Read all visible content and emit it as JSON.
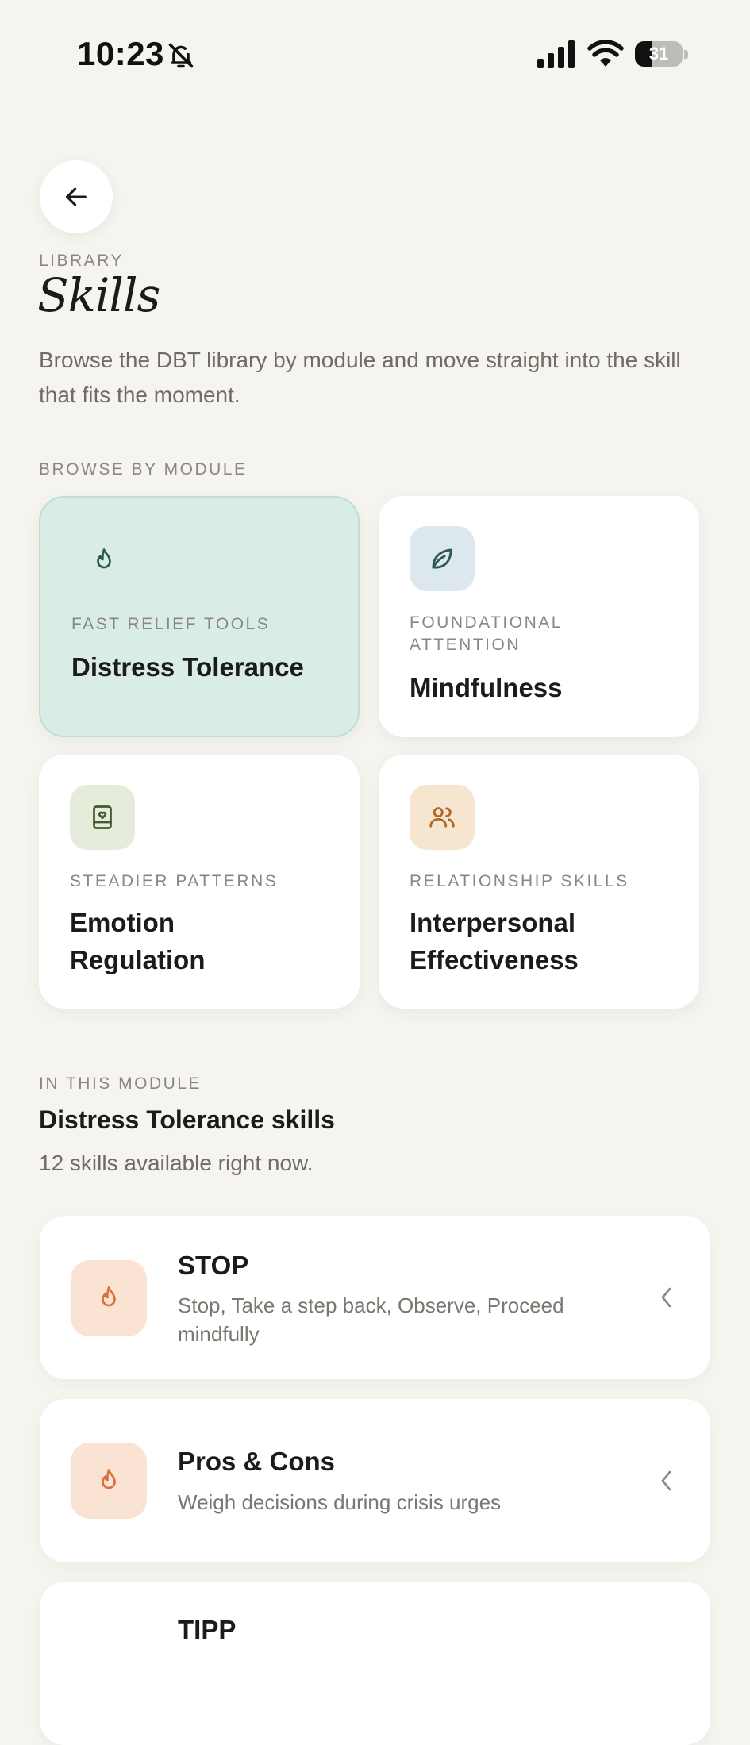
{
  "status_bar": {
    "time": "10:23",
    "battery": "31",
    "battery_level": 0.31
  },
  "header": {
    "eyebrow": "LIBRARY",
    "title": "Skills",
    "description": "Browse the DBT library by module and move straight into the skill that fits the moment."
  },
  "browse": {
    "label": "BROWSE BY MODULE",
    "modules": [
      {
        "subtitle": "FAST RELIEF TOOLS",
        "title": "Distress Tolerance",
        "icon": "flame-icon",
        "color": "#d9ece6",
        "selected": true
      },
      {
        "subtitle": "FOUNDATIONAL ATTENTION",
        "title": "Mindfulness",
        "icon": "leaf-icon",
        "color": "#dde7ee"
      },
      {
        "subtitle": "STEADIER PATTERNS",
        "title": "Emotion Regulation",
        "icon": "journal-heart-icon",
        "color": "#e6ecdc"
      },
      {
        "subtitle": "RELATIONSHIP SKILLS",
        "title": "Interpersonal Effectiveness",
        "icon": "users-icon",
        "color": "#f7e6cf"
      }
    ]
  },
  "module_section": {
    "eyebrow": "IN THIS MODULE",
    "title": "Distress Tolerance skills",
    "count": "12 skills available right now."
  },
  "skills": [
    {
      "title": "STOP",
      "description": "Stop, Take a step back, Observe, Proceed mindfully",
      "icon": "flame-icon"
    },
    {
      "title": "Pros & Cons",
      "description": "Weigh decisions during crisis urges",
      "icon": "flame-icon"
    },
    {
      "title": "TIPP",
      "description": "",
      "icon": "flame-icon"
    }
  ],
  "colors": {
    "background": "#f6f4ef",
    "accent_selected": "#d9ece6",
    "skill_icon_bg": "#fbe3d3",
    "flame": "#d7703a"
  }
}
